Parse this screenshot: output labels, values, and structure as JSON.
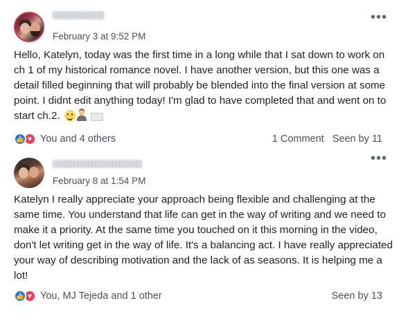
{
  "posts": [
    {
      "timestamp": "February 3 at 9:52 PM",
      "more_label": "•••",
      "body": "Hello, Katelyn, today was the first time in a long while that I sat down to work on ch 1 of my historical romance novel. I have another version, but this one was a detail filled beginning that will probably be blended into the final version at some point. I didnt edit anything today! I'm glad to have completed that and went on to start ch.2.",
      "emojis": [
        "smiling-face-icon",
        "person-icon",
        "laptop-icon"
      ],
      "reactions_text": "You and 4 others",
      "comments_text": "1 Comment",
      "seen_text": "Seen by 11"
    },
    {
      "timestamp": "February 8 at 1:54 PM",
      "more_label": "•••",
      "body": "Katelyn I really appreciate your approach being flexible and challenging at the same time. You understand that life can get in the way of writing and we need to make it a priority. At the same time you touched on it this morning in the video, don't let writing get in the way of life. It's a balancing act. I have really appreciated your way of describing motivation and the lack of as seasons. It is helping me a lot!",
      "reactions_text": "You, MJ Tejeda and 1 other",
      "seen_text": "Seen by 13"
    }
  ],
  "icons": {
    "like": "thumbs-up-icon",
    "love": "heart-icon",
    "like_glyph": "👍",
    "love_glyph": "♥"
  },
  "colors": {
    "like_blue": "#1877f2",
    "love_red": "#f33e58",
    "meta_gray": "#4b4f56"
  }
}
